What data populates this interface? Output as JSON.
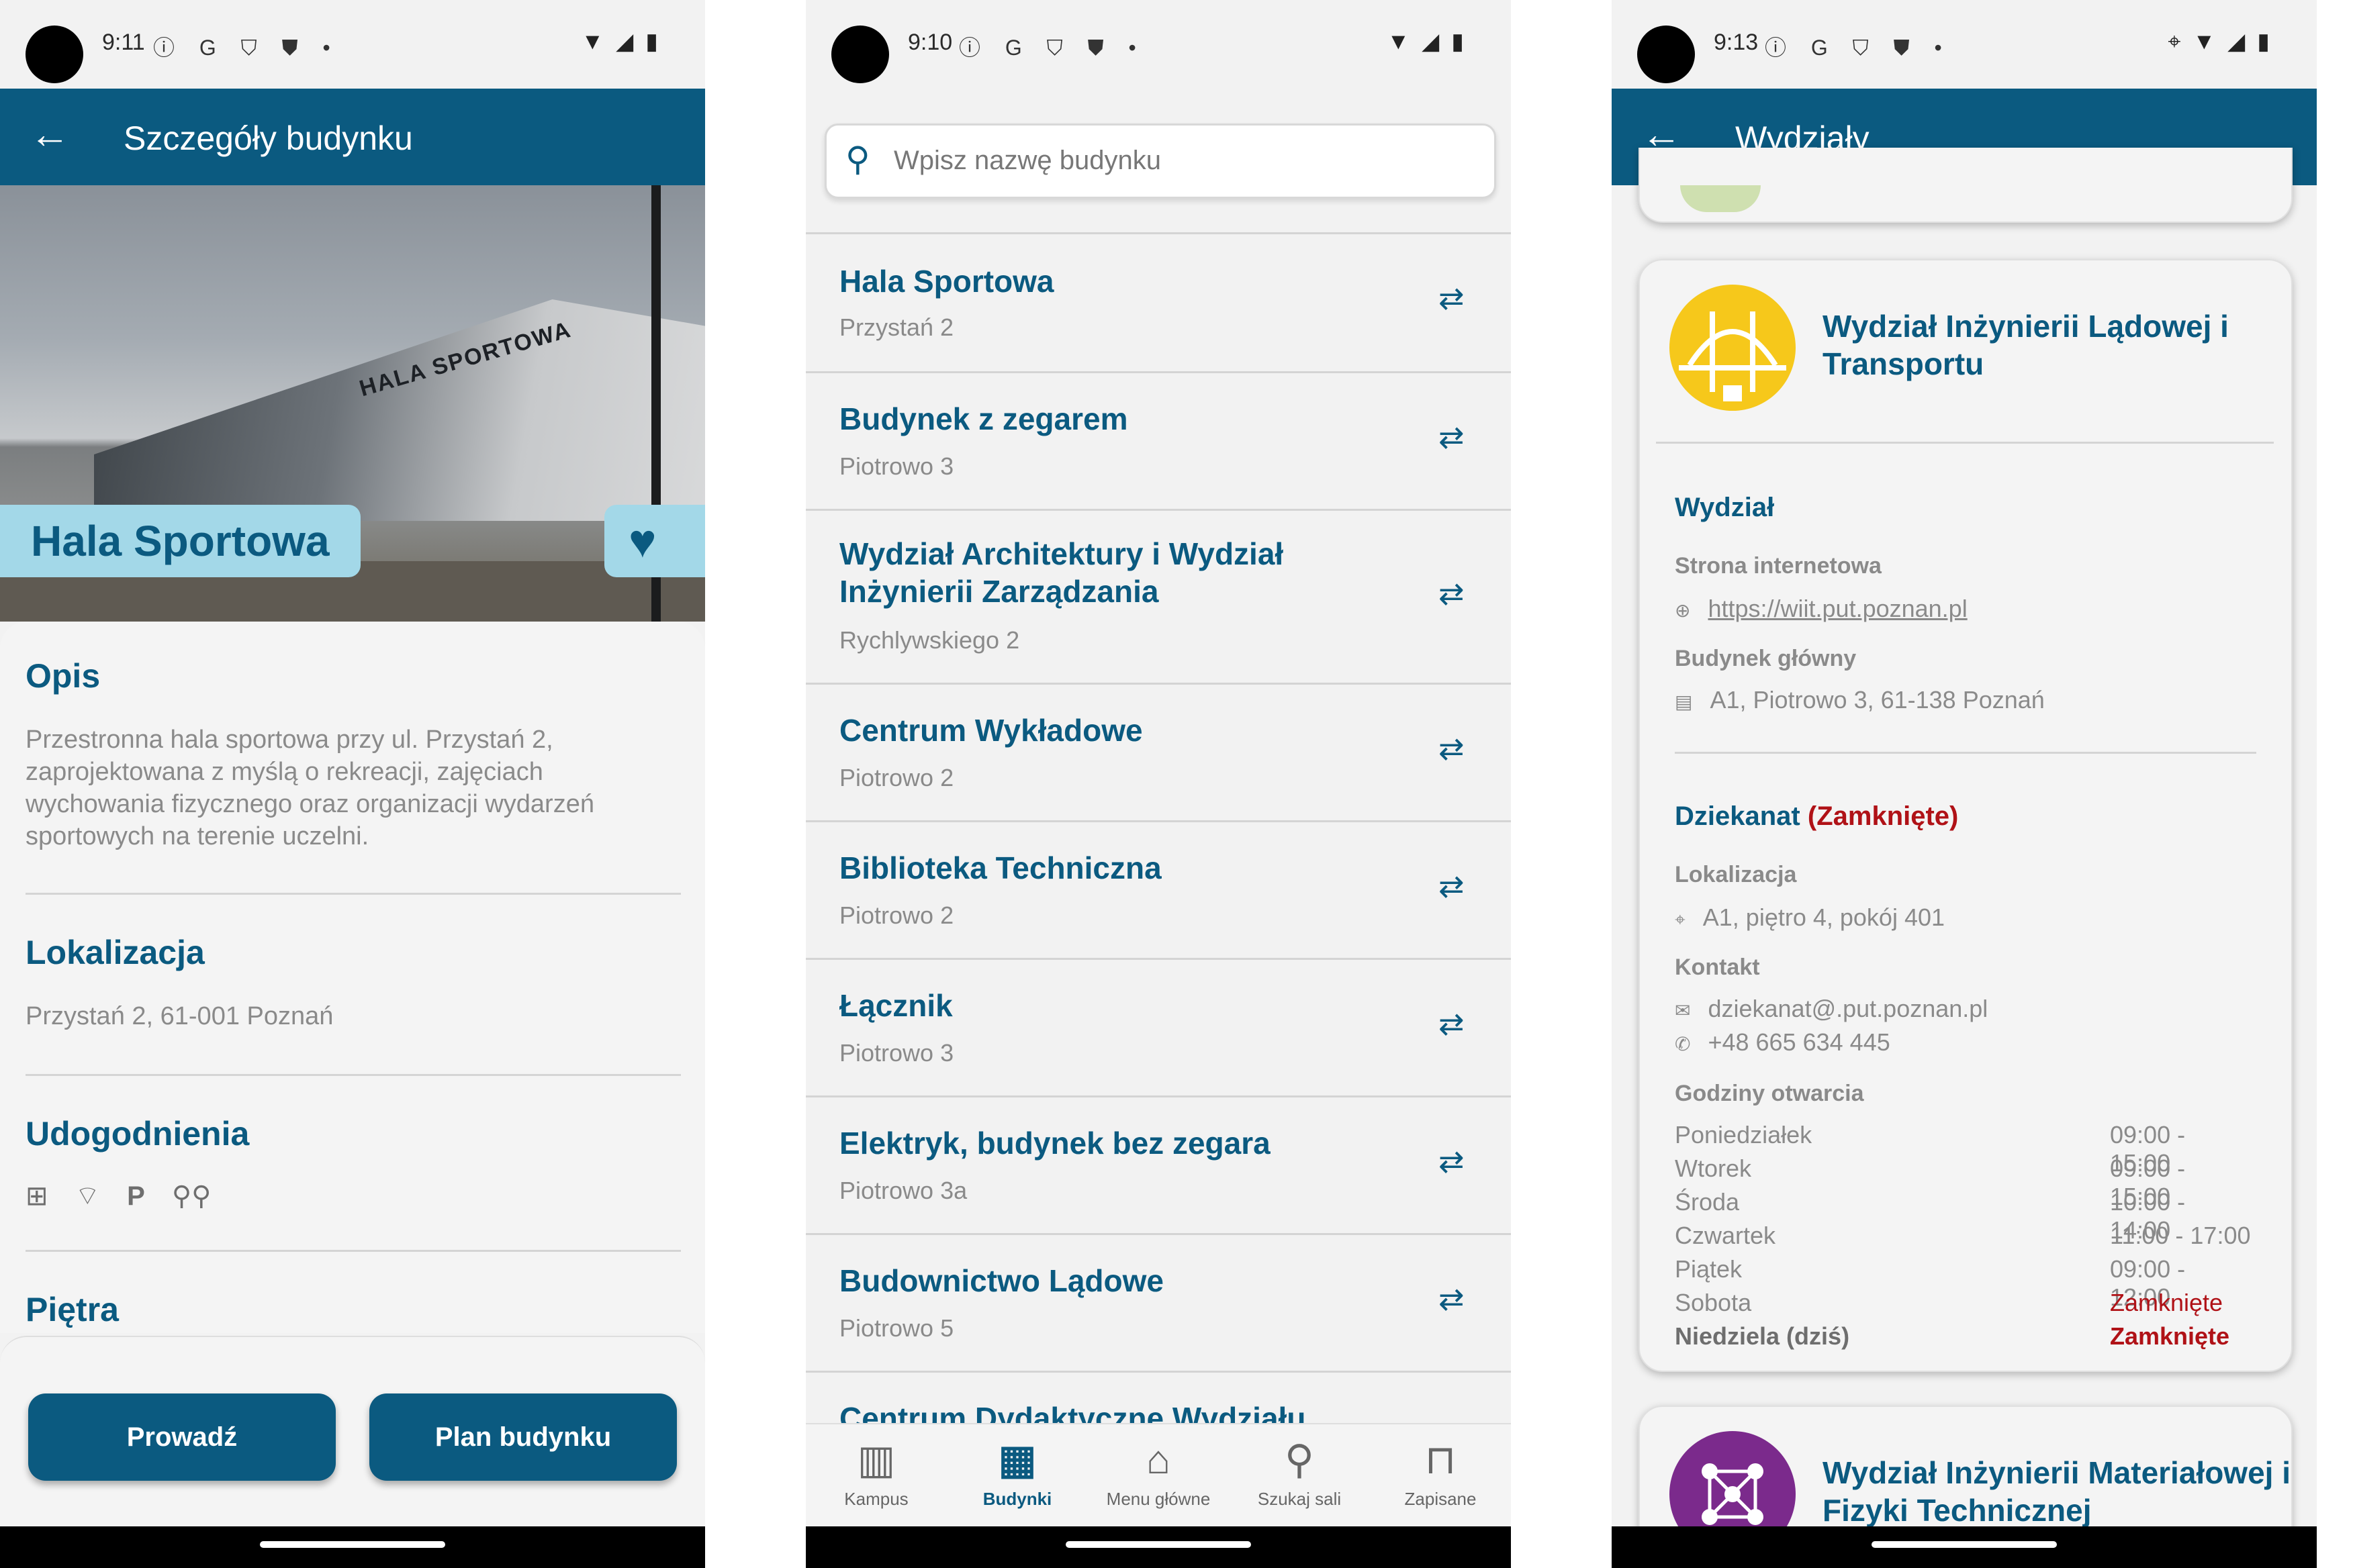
{
  "phone1": {
    "status": {
      "time": "9:11",
      "left_icons": "ⓘ G ⛉ ⛊ •",
      "right_icons": [
        "wifi",
        "signal",
        "battery"
      ]
    },
    "appbar": {
      "back": "←",
      "title": "Szczegóły budynku"
    },
    "hero": {
      "name": "Hala Sportowa",
      "sign": "HALA SPORTOWA",
      "favorite_icon": "♥"
    },
    "opis": {
      "heading": "Opis",
      "text": "Przestronna hala sportowa przy ul. Przystań 2, zaprojektowana z myślą o rekreacji, zajęciach wychowania fizycznego oraz organizacji wydarzeń sportowych na terenie uczelni."
    },
    "lokalizacja": {
      "heading": "Lokalizacja",
      "text": "Przystań 2, 61-001 Poznań"
    },
    "udogodnienia": {
      "heading": "Udogodnienia",
      "icons": [
        "first-aid-icon",
        "wifi-icon",
        "parking-icon",
        "bike-icon"
      ]
    },
    "pietra": {
      "heading": "Piętra"
    },
    "buttons": {
      "navigate": "Prowadź",
      "plan": "Plan budynku"
    }
  },
  "phone2": {
    "status": {
      "time": "9:10",
      "left_icons": "ⓘ G ⛉ ⛊ •"
    },
    "search": {
      "placeholder": "Wpisz nazwę budynku"
    },
    "buildings": [
      {
        "name": "Hala Sportowa",
        "address": "Przystań 2"
      },
      {
        "name": "Budynek z zegarem",
        "address": "Piotrowo 3"
      },
      {
        "name": "Wydział Architektury i Wydział Inżynierii Zarządzania",
        "address": "Rychlywskiego 2"
      },
      {
        "name": "Centrum Wykładowe",
        "address": "Piotrowo 2"
      },
      {
        "name": "Biblioteka Techniczna",
        "address": "Piotrowo 2"
      },
      {
        "name": "Łącznik",
        "address": "Piotrowo 3"
      },
      {
        "name": "Elektryk, budynek bez zegara",
        "address": "Piotrowo 3a"
      },
      {
        "name": "Budownictwo Lądowe",
        "address": "Piotrowo 5"
      },
      {
        "name": "Centrum Dydaktyczne Wydziału",
        "address": ""
      }
    ],
    "nav": [
      {
        "label": "Kampus",
        "icon": "map-icon"
      },
      {
        "label": "Budynki",
        "icon": "buildings-icon",
        "active": true
      },
      {
        "label": "Menu główne",
        "icon": "home-icon"
      },
      {
        "label": "Szukaj sali",
        "icon": "search-icon"
      },
      {
        "label": "Zapisane",
        "icon": "bookmark-icon"
      }
    ]
  },
  "phone3": {
    "status": {
      "time": "9:13",
      "left_icons": "ⓘ G ⛉ ⛊ •"
    },
    "appbar": {
      "back": "←",
      "title": "Wydziały"
    },
    "faculty": {
      "name": "Wydział Inżynierii Lądowej i Transportu",
      "section": "Wydział",
      "website_label": "Strona internetowa",
      "website": "https://wiit.put.poznan.pl",
      "main_building_label": "Budynek główny",
      "main_building": "A1, Piotrowo 3, 61-138 Poznań",
      "dean_office": "Dziekanat",
      "dean_status": "(Zamknięte)",
      "location_label": "Lokalizacja",
      "location": "A1, piętro 4, pokój 401",
      "contact_label": "Kontakt",
      "email": "dziekanat@.put.poznan.pl",
      "phone": "+48 665 634 445",
      "hours_label": "Godziny otwarcia",
      "hours": [
        {
          "day": "Poniedziałek",
          "time": "09:00 - 15:00"
        },
        {
          "day": "Wtorek",
          "time": "09:00 - 15:00"
        },
        {
          "day": "Środa",
          "time": "10:00 - 14:00"
        },
        {
          "day": "Czwartek",
          "time": "11:00 - 17:00"
        },
        {
          "day": "Piątek",
          "time": "09:00 - 12:00"
        },
        {
          "day": "Sobota",
          "time": "Zamknięte",
          "closed": true
        },
        {
          "day": "Niedziela (dziś)",
          "time": "Zamknięte",
          "closed": true,
          "today": true
        }
      ]
    },
    "next_faculty": {
      "name": "Wydział Inżynierii Materiałowej i Fizyki Technicznej"
    }
  },
  "colors": {
    "primary": "#0b5a80",
    "hero_label_bg": "#a3d8e8",
    "closed": "#b01217",
    "text_muted": "#8a8a8a"
  }
}
